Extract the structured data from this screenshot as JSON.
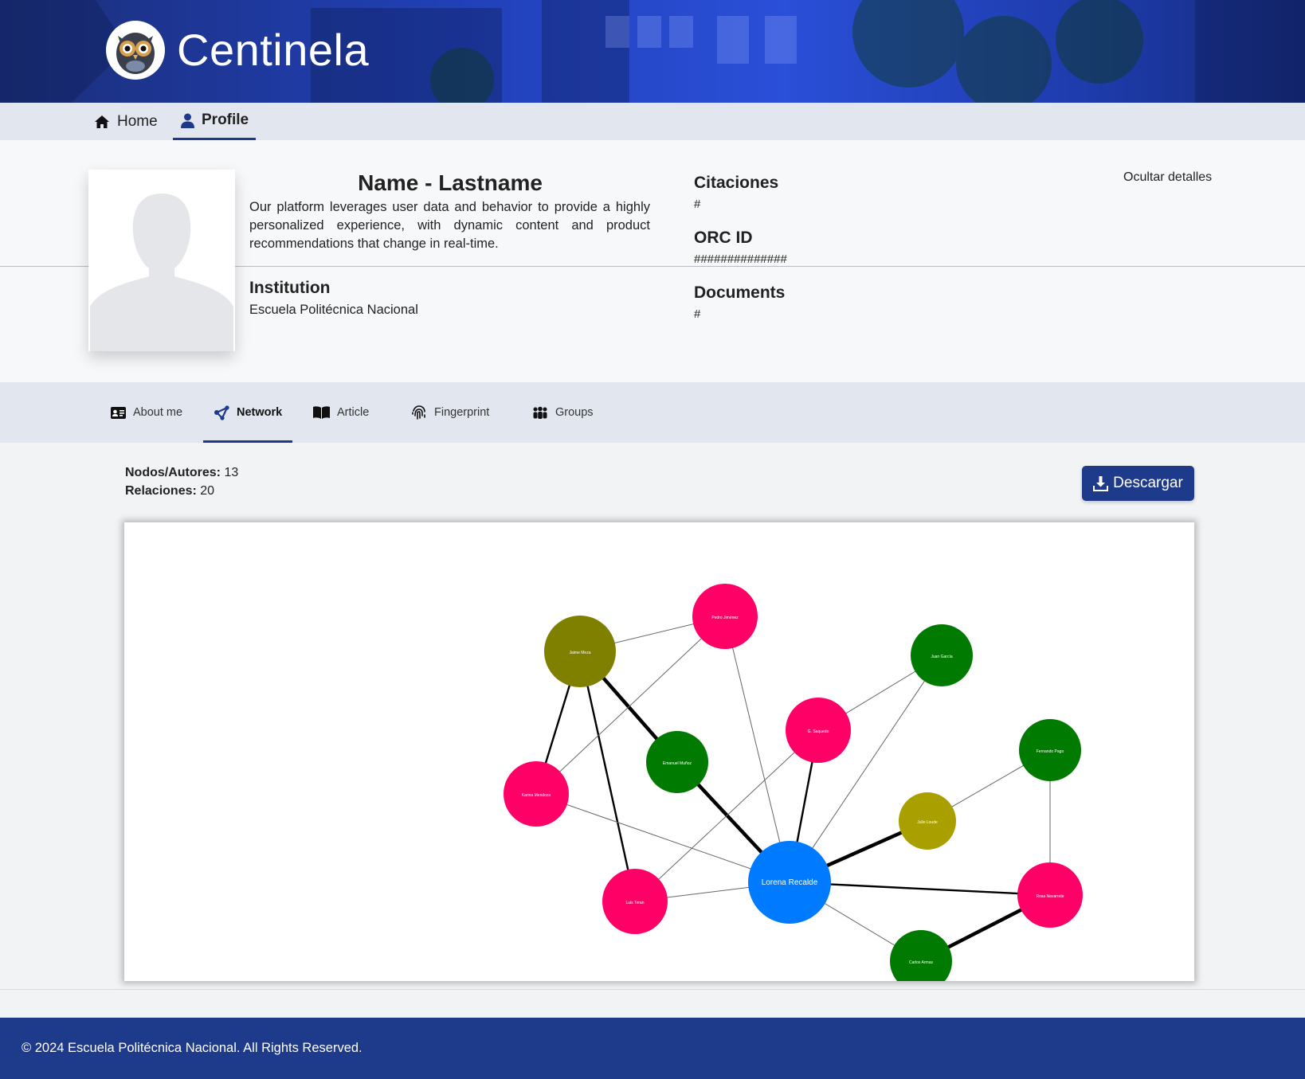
{
  "header": {
    "app_name": "Centinela",
    "logo_icon": "owl-logo"
  },
  "topnav": {
    "items": [
      {
        "label": "Home",
        "icon": "home-icon"
      },
      {
        "label": "Profile",
        "icon": "user-icon",
        "active": true
      }
    ]
  },
  "profile": {
    "name": "Name - Lastname",
    "bio": "Our platform leverages user data and behavior to provide a highly personalized experience, with dynamic content and product recommendations that change in real-time.",
    "institution_label": "Institution",
    "institution_value": "Escuela Politécnica Nacional",
    "citations_label": "Citaciones",
    "citations_value": "#",
    "orcid_label": "ORC ID",
    "orcid_value": "##############",
    "documents_label": "Documents",
    "documents_value": "#",
    "toggle_label": "Ocultar detalles"
  },
  "tabs": [
    {
      "label": "About me",
      "icon": "id-card-icon"
    },
    {
      "label": "Network",
      "icon": "network-icon",
      "active": true
    },
    {
      "label": "Article",
      "icon": "book-icon"
    },
    {
      "label": "Fingerprint",
      "icon": "fingerprint-icon"
    },
    {
      "label": "Groups",
      "icon": "groups-icon"
    }
  ],
  "stats": {
    "nodes_label": "Nodos/Autores:",
    "nodes_value": "13",
    "relations_label": "Relaciones:",
    "relations_value": "20"
  },
  "download_label": "Descargar",
  "colors": {
    "brand": "#1e3a8a",
    "center_node": "#007bff",
    "pink_node": "#ff0066",
    "green_node": "#007a00",
    "olive_node": "#808000",
    "yellow_node": "#a9a000"
  },
  "network": {
    "nodes": [
      {
        "id": "lorena",
        "label": "Lorena Recalde",
        "color": "#007bff"
      },
      {
        "id": "jaime",
        "label": "Jaime Meza",
        "color": "#808000"
      },
      {
        "id": "pedro",
        "label": "Pedro Jiménez",
        "color": "#ff0066"
      },
      {
        "id": "juan",
        "label": "Juan García",
        "color": "#007a00"
      },
      {
        "id": "gsaq",
        "label": "G. Saquedo",
        "color": "#ff0066"
      },
      {
        "id": "emanuel",
        "label": "Emanuel Muñoz",
        "color": "#007a00"
      },
      {
        "id": "karina",
        "label": "Karina Mendoza",
        "color": "#ff0066"
      },
      {
        "id": "fernando",
        "label": "Fernando Pago",
        "color": "#007a00"
      },
      {
        "id": "julio",
        "label": "Julio Loude",
        "color": "#a9a000"
      },
      {
        "id": "luis",
        "label": "Luis Teran",
        "color": "#ff0066"
      },
      {
        "id": "rosa",
        "label": "Rosa Navarrete",
        "color": "#ff0066"
      },
      {
        "id": "carlos",
        "label": "Carlos Armas",
        "color": "#007a00"
      }
    ],
    "edges": [
      {
        "source": "jaime",
        "target": "pedro",
        "weight": 1
      },
      {
        "source": "jaime",
        "target": "emanuel",
        "weight": 3
      },
      {
        "source": "emanuel",
        "target": "lorena",
        "weight": 3
      },
      {
        "source": "jaime",
        "target": "karina",
        "weight": 2
      },
      {
        "source": "jaime",
        "target": "luis",
        "weight": 2
      },
      {
        "source": "pedro",
        "target": "karina",
        "weight": 1
      },
      {
        "source": "pedro",
        "target": "lorena",
        "weight": 1
      },
      {
        "source": "juan",
        "target": "gsaq",
        "weight": 1
      },
      {
        "source": "juan",
        "target": "lorena",
        "weight": 1
      },
      {
        "source": "gsaq",
        "target": "lorena",
        "weight": 2
      },
      {
        "source": "gsaq",
        "target": "luis",
        "weight": 1
      },
      {
        "source": "karina",
        "target": "lorena",
        "weight": 1
      },
      {
        "source": "luis",
        "target": "lorena",
        "weight": 1
      },
      {
        "source": "julio",
        "target": "lorena",
        "weight": 3
      },
      {
        "source": "julio",
        "target": "fernando",
        "weight": 1
      },
      {
        "source": "fernando",
        "target": "rosa",
        "weight": 1
      },
      {
        "source": "lorena",
        "target": "rosa",
        "weight": 2
      },
      {
        "source": "lorena",
        "target": "carlos",
        "weight": 1
      },
      {
        "source": "carlos",
        "target": "rosa",
        "weight": 3
      }
    ]
  },
  "footer": {
    "text": "© 2024 Escuela Politécnica Nacional. All Rights Reserved."
  }
}
